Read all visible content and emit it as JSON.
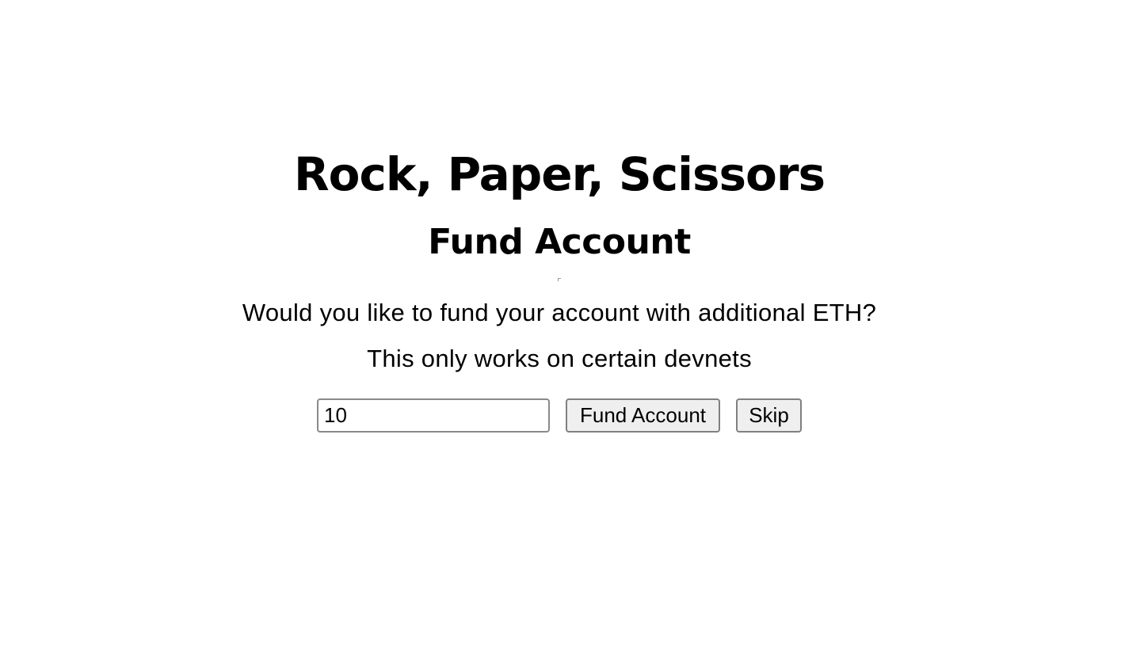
{
  "header": {
    "title": "Rock, Paper, Scissors",
    "subtitle": "Fund Account"
  },
  "main": {
    "question": "Would you like to fund your account with additional ETH?",
    "note": "This only works on certain devnets"
  },
  "form": {
    "amount_value": "10",
    "fund_label": "Fund Account",
    "skip_label": "Skip"
  }
}
